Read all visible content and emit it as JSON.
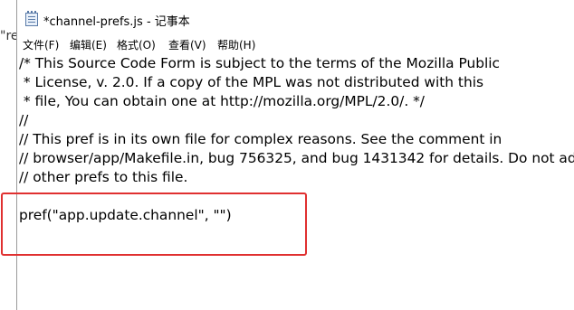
{
  "background_fragment": "\"re",
  "window": {
    "title": "*channel-prefs.js - 记事本",
    "app_icon": "notepad-icon"
  },
  "menubar": {
    "items": [
      {
        "label": "文件(F)"
      },
      {
        "label": "编辑(E)"
      },
      {
        "label": "格式(O)"
      },
      {
        "label": "查看(V)"
      },
      {
        "label": "帮助(H)"
      }
    ]
  },
  "editor": {
    "lines": [
      "/* This Source Code Form is subject to the terms of the Mozilla Public",
      " * License, v. 2.0. If a copy of the MPL was not distributed with this",
      " * file, You can obtain one at http://mozilla.org/MPL/2.0/. */",
      "//",
      "// This pref is in its own file for complex reasons. See the comment in",
      "// browser/app/Makefile.in, bug 756325, and bug 1431342 for details. Do not ad",
      "// other prefs to this file.",
      "",
      "pref(\"app.update.channel\", \"\")"
    ]
  },
  "colors": {
    "highlight": "#e03030",
    "text": "#000000",
    "background": "#ffffff"
  }
}
